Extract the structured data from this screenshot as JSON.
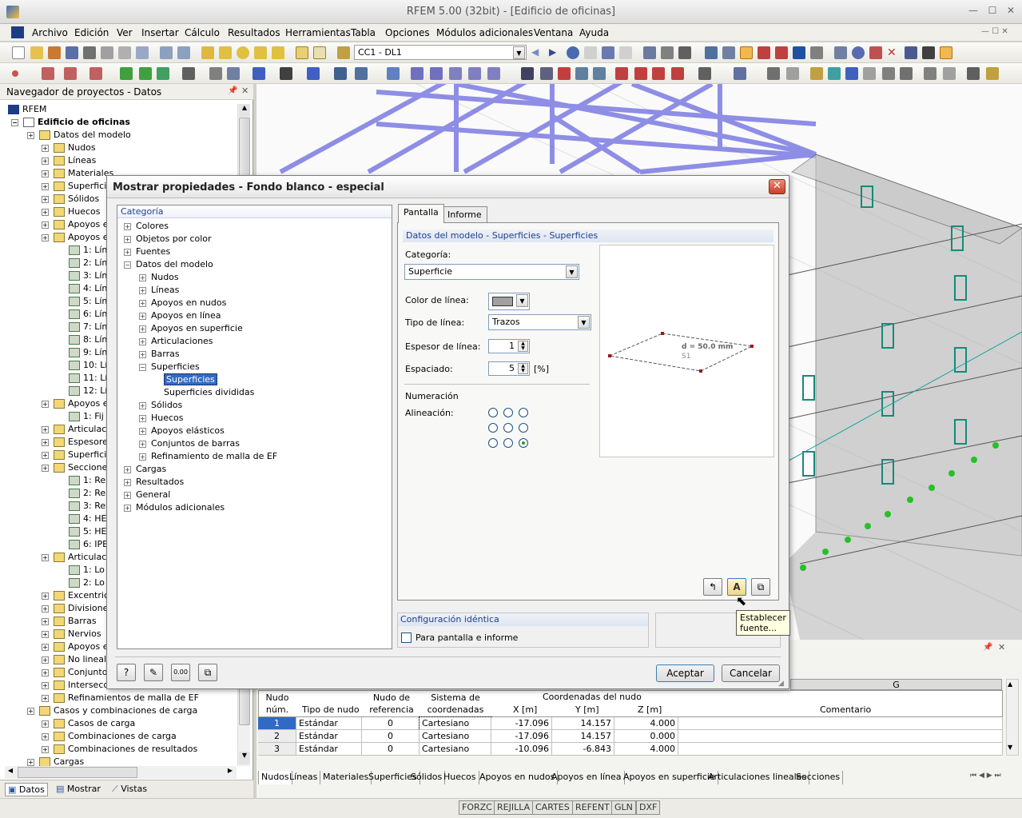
{
  "window": {
    "title": "RFEM 5.00 (32bit) - [Edificio de oficinas]"
  },
  "menu": [
    "Archivo",
    "Edición",
    "Ver",
    "Insertar",
    "Cálculo",
    "Resultados",
    "Herramientas",
    "Tabla",
    "Opciones",
    "Módulos adicionales",
    "Ventana",
    "Ayuda"
  ],
  "toolbar": {
    "loadcase": "CC1 - DL1"
  },
  "navigator": {
    "title": "Navegador de proyectos - Datos",
    "root": "RFEM",
    "project": "Edificio de oficinas",
    "items": [
      {
        "label": "Datos del modelo",
        "lvl": 1
      },
      {
        "label": "Nudos",
        "lvl": 2
      },
      {
        "label": "Líneas",
        "lvl": 2
      },
      {
        "label": "Materiales",
        "lvl": 2
      },
      {
        "label": "Superficies",
        "lvl": 2
      },
      {
        "label": "Sólidos",
        "lvl": 2
      },
      {
        "label": "Huecos",
        "lvl": 2
      },
      {
        "label": "Apoyos e",
        "lvl": 2
      },
      {
        "label": "Apoyos e",
        "lvl": 2
      },
      {
        "label": "1: Lín",
        "lvl": 3
      },
      {
        "label": "2: Lín",
        "lvl": 3
      },
      {
        "label": "3: Lín",
        "lvl": 3
      },
      {
        "label": "4: Lín",
        "lvl": 3
      },
      {
        "label": "5: Lín",
        "lvl": 3
      },
      {
        "label": "6: Lín",
        "lvl": 3
      },
      {
        "label": "7: Lín",
        "lvl": 3
      },
      {
        "label": "8: Lín",
        "lvl": 3
      },
      {
        "label": "9: Lín",
        "lvl": 3
      },
      {
        "label": "10: Lí",
        "lvl": 3
      },
      {
        "label": "11: Lí",
        "lvl": 3
      },
      {
        "label": "12: Lí",
        "lvl": 3
      },
      {
        "label": "Apoyos e",
        "lvl": 2
      },
      {
        "label": "1: Fij",
        "lvl": 3
      },
      {
        "label": "Articulaci",
        "lvl": 2
      },
      {
        "label": "Espesore",
        "lvl": 2
      },
      {
        "label": "Superficie",
        "lvl": 2
      },
      {
        "label": "Secciones",
        "lvl": 2
      },
      {
        "label": "1: Re",
        "lvl": 3
      },
      {
        "label": "2: Re",
        "lvl": 3
      },
      {
        "label": "3: Re",
        "lvl": 3
      },
      {
        "label": "4: HE",
        "lvl": 3
      },
      {
        "label": "5: HE",
        "lvl": 3
      },
      {
        "label": "6: IPE",
        "lvl": 3
      },
      {
        "label": "Articulaci",
        "lvl": 2
      },
      {
        "label": "1: Lo",
        "lvl": 3
      },
      {
        "label": "2: Lo",
        "lvl": 3
      },
      {
        "label": "Excentric",
        "lvl": 2
      },
      {
        "label": "Divisiones",
        "lvl": 2
      },
      {
        "label": "Barras",
        "lvl": 2
      },
      {
        "label": "Nervios",
        "lvl": 2
      },
      {
        "label": "Apoyos e",
        "lvl": 2
      },
      {
        "label": "No linealid",
        "lvl": 2
      },
      {
        "label": "Conjunto",
        "lvl": 2
      },
      {
        "label": "Intersecc",
        "lvl": 2
      },
      {
        "label": "Refinamientos de malla de EF",
        "lvl": 2
      },
      {
        "label": "Casos y combinaciones de carga",
        "lvl": 1
      },
      {
        "label": "Casos de carga",
        "lvl": 2
      },
      {
        "label": "Combinaciones de carga",
        "lvl": 2
      },
      {
        "label": "Combinaciones de resultados",
        "lvl": 2
      },
      {
        "label": "Cargas",
        "lvl": 1
      }
    ],
    "tabs": [
      "Datos",
      "Mostrar",
      "Vistas"
    ]
  },
  "dialog": {
    "title": "Mostrar propiedades - Fondo blanco - especial",
    "category_header": "Categoría",
    "tree": [
      {
        "label": "Colores",
        "lvl": 0,
        "exp": "+"
      },
      {
        "label": "Objetos por color",
        "lvl": 0,
        "exp": "+"
      },
      {
        "label": "Fuentes",
        "lvl": 0,
        "exp": "+"
      },
      {
        "label": "Datos del modelo",
        "lvl": 0,
        "exp": "-"
      },
      {
        "label": "Nudos",
        "lvl": 1,
        "exp": "+"
      },
      {
        "label": "Líneas",
        "lvl": 1,
        "exp": "+"
      },
      {
        "label": "Apoyos en nudos",
        "lvl": 1,
        "exp": "+"
      },
      {
        "label": "Apoyos en línea",
        "lvl": 1,
        "exp": "+"
      },
      {
        "label": "Apoyos en superficie",
        "lvl": 1,
        "exp": "+"
      },
      {
        "label": "Articulaciones",
        "lvl": 1,
        "exp": "+"
      },
      {
        "label": "Barras",
        "lvl": 1,
        "exp": "+"
      },
      {
        "label": "Superficies",
        "lvl": 1,
        "exp": "-"
      },
      {
        "label": "Superficies",
        "lvl": 2,
        "exp": "",
        "sel": true
      },
      {
        "label": "Superficies divididas",
        "lvl": 2,
        "exp": ""
      },
      {
        "label": "Sólidos",
        "lvl": 1,
        "exp": "+"
      },
      {
        "label": "Huecos",
        "lvl": 1,
        "exp": "+"
      },
      {
        "label": "Apoyos elásticos",
        "lvl": 1,
        "exp": "+"
      },
      {
        "label": "Conjuntos de barras",
        "lvl": 1,
        "exp": "+"
      },
      {
        "label": "Refinamiento de malla de EF",
        "lvl": 1,
        "exp": "+"
      },
      {
        "label": "Cargas",
        "lvl": 0,
        "exp": "+"
      },
      {
        "label": "Resultados",
        "lvl": 0,
        "exp": "+"
      },
      {
        "label": "General",
        "lvl": 0,
        "exp": "+"
      },
      {
        "label": "Módulos adicionales",
        "lvl": 0,
        "exp": "+"
      }
    ],
    "tab_screen": "Pantalla",
    "tab_report": "Informe",
    "section_title": "Datos del modelo - Superficies - Superficies",
    "category_label": "Categoría:",
    "category_value": "Superficie",
    "line_color_label": "Color de línea:",
    "line_color": "#a0a0a0",
    "line_type_label": "Tipo de línea:",
    "line_type_value": "Trazos",
    "line_width_label": "Espesor de línea:",
    "line_width_value": "1",
    "spacing_label": "Espaciado:",
    "spacing_value": "5",
    "spacing_unit": "[%]",
    "numbering_label": "Numeración",
    "alignment_label": "Alineación:",
    "alignment_selected": "bottom-right",
    "preview_thickness": "d = 50.0 mm",
    "preview_surface": "S1",
    "identical_title": "Configuración idéntica",
    "identical_checkbox": "Para pantalla e informe",
    "identical_checked": false,
    "tooltip": "Establecer fuente...",
    "ok": "Aceptar",
    "cancel": "Cancelar"
  },
  "table": {
    "col_g": "G",
    "headers": {
      "node": "Nudo núm.",
      "type": "Tipo de nudo",
      "ref": "Nudo de referencia",
      "sys": "Sistema de coordenadas",
      "coords": "Coordenadas del nudo",
      "x": "X [m]",
      "y": "Y [m]",
      "z": "Z [m]",
      "comment": "Comentario"
    },
    "rows": [
      {
        "n": "1",
        "type": "Estándar",
        "ref": "0",
        "sys": "Cartesiano",
        "x": "-17.096",
        "y": "14.157",
        "z": "4.000"
      },
      {
        "n": "2",
        "type": "Estándar",
        "ref": "0",
        "sys": "Cartesiano",
        "x": "-17.096",
        "y": "14.157",
        "z": "0.000"
      },
      {
        "n": "3",
        "type": "Estándar",
        "ref": "0",
        "sys": "Cartesiano",
        "x": "-10.096",
        "y": "-6.843",
        "z": "4.000"
      }
    ],
    "tabs": [
      "Nudos",
      "Líneas",
      "Materiales",
      "Superficies",
      "Sólidos",
      "Huecos",
      "Apoyos en nudos",
      "Apoyos en línea",
      "Apoyos en superficie",
      "Articulaciones lineales",
      "Secciones"
    ]
  },
  "status": [
    "FORZC",
    "REJILLA",
    "CARTES",
    "REFENT",
    "GLN",
    "DXF"
  ]
}
